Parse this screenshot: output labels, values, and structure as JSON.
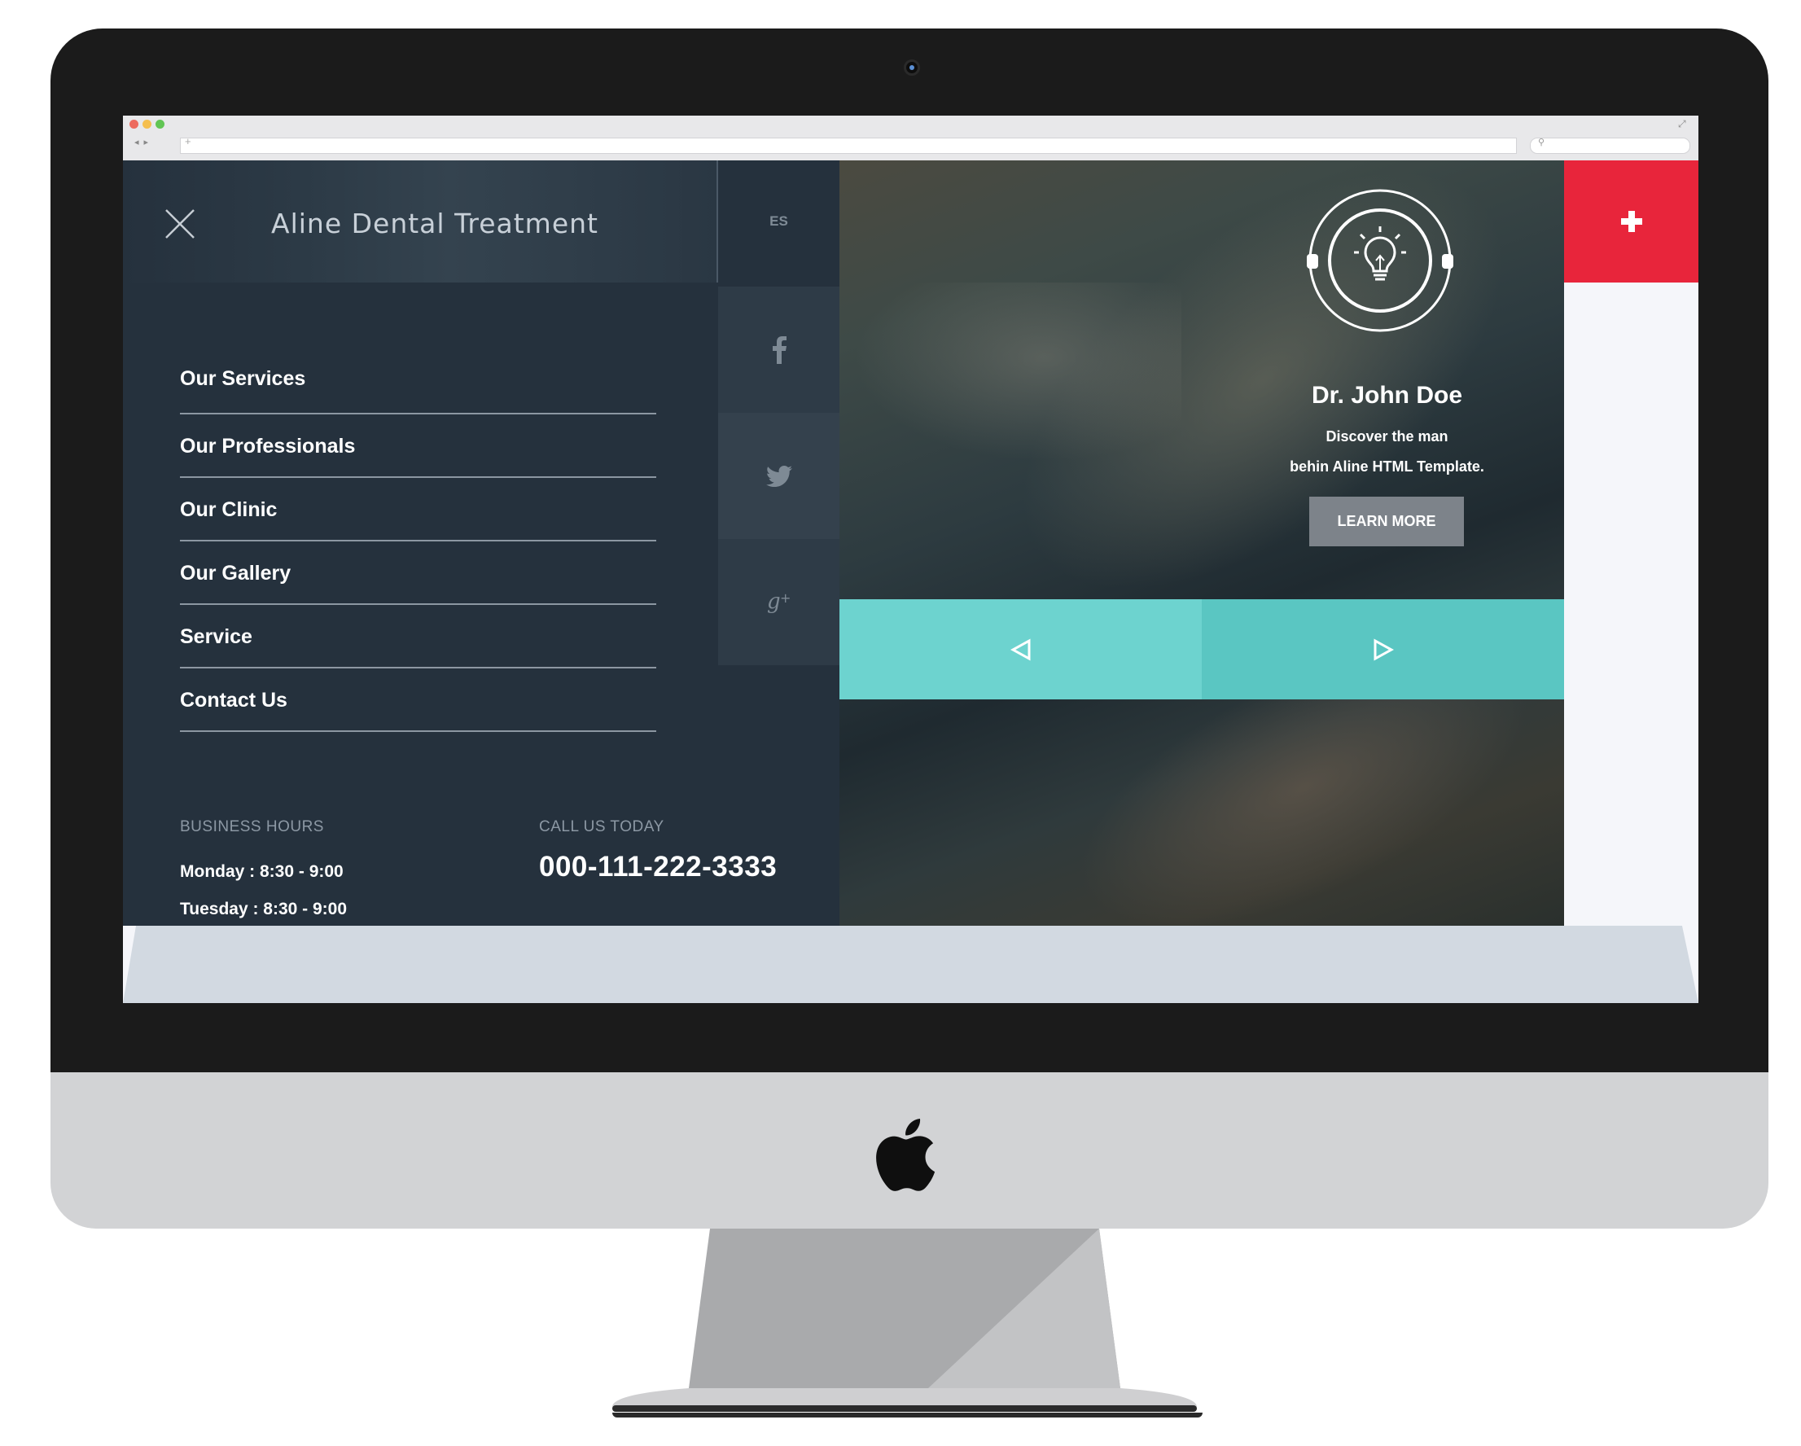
{
  "brand": {
    "name": "Aline Dental Treatment"
  },
  "header": {
    "language": "ES"
  },
  "social": [
    {
      "icon": "facebook-icon"
    },
    {
      "icon": "twitter-icon"
    },
    {
      "icon": "google-plus-icon"
    }
  ],
  "menu": {
    "items": [
      {
        "label": "Our Services"
      },
      {
        "label": "Our Professionals"
      },
      {
        "label": "Our Clinic"
      },
      {
        "label": "Our Gallery"
      },
      {
        "label": "Service"
      },
      {
        "label": "Contact Us"
      }
    ]
  },
  "hours": {
    "label": "BUSINESS HOURS",
    "lines": [
      "Monday : 8:30 - 9:00",
      "Tuesday : 8:30 - 9:00"
    ]
  },
  "call": {
    "label": "CALL US TODAY",
    "phone": "000-111-222-3333"
  },
  "hero": {
    "name": "Dr. John Doe",
    "line1": "Discover the man",
    "line2": "behin Aline HTML Template.",
    "button": "LEARN MORE"
  },
  "colors": {
    "menu_bg": "#25313d",
    "accent_red": "#e8253b",
    "teal": "#6dd3cf",
    "teal_dark": "#5ac6c2"
  }
}
